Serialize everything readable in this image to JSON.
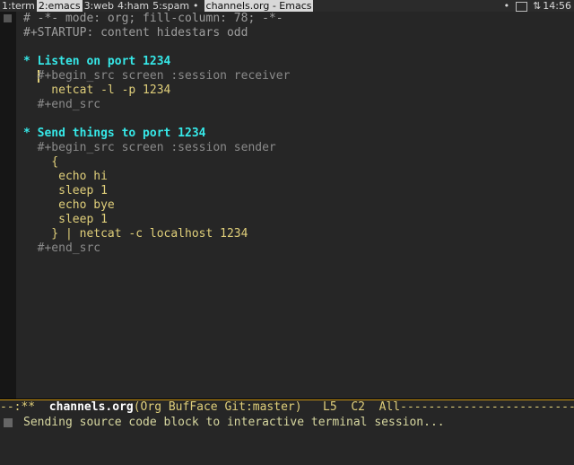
{
  "topbar": {
    "workspaces": [
      {
        "label": "1:term",
        "active": false
      },
      {
        "label": "2:emacs",
        "active": true
      },
      {
        "label": "3:web",
        "active": false
      },
      {
        "label": "4:ham",
        "active": false
      },
      {
        "label": "5:spam",
        "active": false
      }
    ],
    "separator": "•",
    "window_title": "channels.org - Emacs",
    "tray_icons": [
      "window-box-icon",
      "network-icon"
    ],
    "clock": "14:56"
  },
  "buffer": {
    "lines": [
      {
        "text": "# -*- mode: org; fill-column: 78; -*-",
        "kind": "comment"
      },
      {
        "text": "#+STARTUP: content hidestars odd",
        "kind": "comment"
      },
      {
        "text": "",
        "kind": "blank"
      },
      {
        "text": "* Listen on port 1234",
        "kind": "heading"
      },
      {
        "text": "  #+begin_src screen :session receiver",
        "kind": "meta"
      },
      {
        "text": "    netcat -l -p 1234",
        "kind": "code"
      },
      {
        "text": "  #+end_src",
        "kind": "meta"
      },
      {
        "text": "",
        "kind": "blank"
      },
      {
        "text": "* Send things to port 1234",
        "kind": "heading"
      },
      {
        "text": "  #+begin_src screen :session sender",
        "kind": "meta"
      },
      {
        "text": "    {",
        "kind": "code"
      },
      {
        "text": "     echo hi",
        "kind": "code"
      },
      {
        "text": "     sleep 1",
        "kind": "code"
      },
      {
        "text": "     echo bye",
        "kind": "code"
      },
      {
        "text": "     sleep 1",
        "kind": "code"
      },
      {
        "text": "    } | netcat -c localhost 1234",
        "kind": "code"
      },
      {
        "text": "  #+end_src",
        "kind": "meta"
      }
    ]
  },
  "modeline": {
    "status": "--:**  ",
    "buffer_name": "channels.org",
    "modes": "(Org BufFace Git:master)",
    "position": "   L5  C2  All",
    "filler": "-----------------------------------------------"
  },
  "minibuffer": {
    "message": "Sending source code block to interactive terminal session..."
  },
  "colors": {
    "background": "#262626",
    "heading": "#36e8e8",
    "code": "#e0cf7a",
    "comment": "#9e9e9e",
    "modeline_accent": "#d29b18"
  }
}
